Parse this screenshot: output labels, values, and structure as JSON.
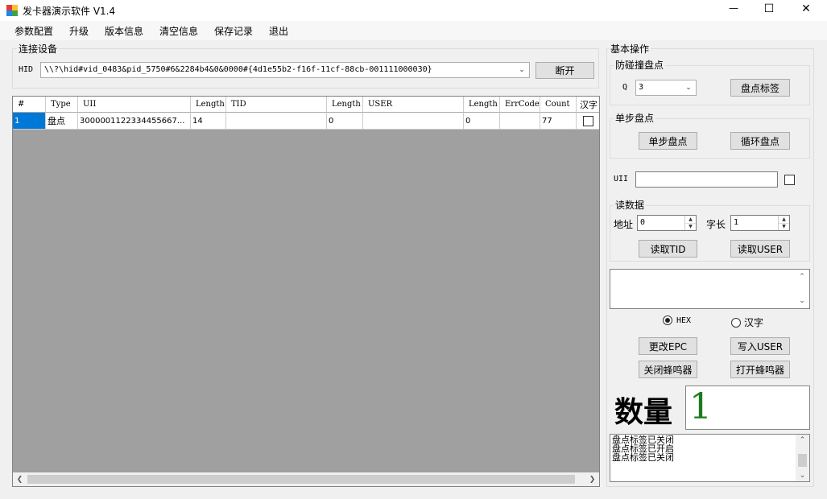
{
  "window": {
    "title": "发卡器演示软件 V1.4",
    "minimize": "—",
    "maximize": "☐",
    "close": "✕"
  },
  "menu": [
    "参数配置",
    "升级",
    "版本信息",
    "清空信息",
    "保存记录",
    "退出"
  ],
  "connect": {
    "legend": "连接设备",
    "label": "HID",
    "device": "\\\\?\\hid#vid_0483&pid_5750#6&2284b4&0&0000#{4d1e55b2-f16f-11cf-88cb-001111000030}",
    "disconnect_label": "断开"
  },
  "table": {
    "headers": [
      "#",
      "Type",
      "UII",
      "Length",
      "TID",
      "Length",
      "USER",
      "Length",
      "ErrCode",
      "Count",
      "汉字"
    ],
    "rows": [
      {
        "index": "1",
        "type": "盘点",
        "uii": "3000001122334455667...",
        "uii_length": "14",
        "tid": "",
        "tid_length": "0",
        "user": "",
        "user_length": "0",
        "errcode": "",
        "count": "77"
      }
    ]
  },
  "basic": {
    "legend": "基本操作",
    "anticollision": {
      "legend": "防碰撞盘点",
      "q_label": "Q",
      "q_value": "3",
      "inventory_tag_label": "盘点标签"
    },
    "single": {
      "legend": "单步盘点",
      "single_label": "单步盘点",
      "loop_label": "循环盘点"
    },
    "uii_label": "UII",
    "uii_value": "",
    "read": {
      "legend": "读数据",
      "addr_label": "地址",
      "addr_value": "0",
      "len_label": "字长",
      "len_value": "1",
      "read_tid_label": "读取TID",
      "read_user_label": "读取USER"
    },
    "data_value": "",
    "format": {
      "hex_label": "HEX",
      "hanzi_label": "汉字",
      "selected": "HEX"
    },
    "change_epc_label": "更改EPC",
    "write_user_label": "写入USER",
    "buzzer_off_label": "关闭蜂鸣器",
    "buzzer_on_label": "打开蜂鸣器",
    "quantity_label": "数量",
    "quantity_value": "1",
    "log": [
      "盘点标签已关闭",
      "盘点标签已开启",
      "盘点标签已关闭"
    ]
  },
  "colors": {
    "accent_green": "#1c7c1c",
    "selection_blue": "#0078d7",
    "grid_bg": "#a0a0a0"
  }
}
